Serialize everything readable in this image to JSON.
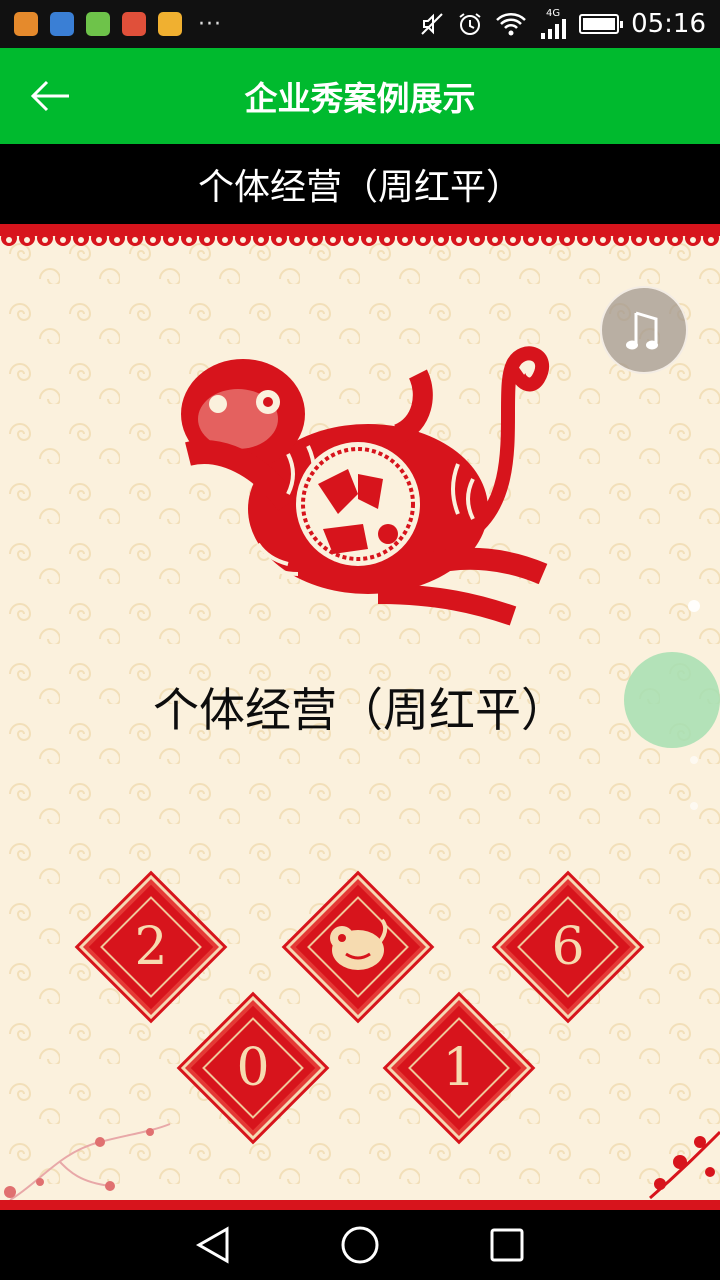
{
  "status_bar": {
    "time": "05:16",
    "network": "4G",
    "dots": "···"
  },
  "app_bar": {
    "title": "企业秀案例展示"
  },
  "sub_bar": {
    "title": "个体经营（周红平）"
  },
  "content": {
    "title": "个体经营（周红平）",
    "diamonds": [
      "2",
      "6",
      "0",
      "1"
    ]
  },
  "colors": {
    "app_bar": "#00ba2e",
    "paper_red": "#d7141c",
    "background": "#fbf1dd"
  },
  "icons": {
    "back": "arrow-left-icon",
    "music": "music-note-icon",
    "nav_back": "triangle-back-icon",
    "nav_home": "circle-home-icon",
    "nav_recent": "square-recent-icon"
  }
}
